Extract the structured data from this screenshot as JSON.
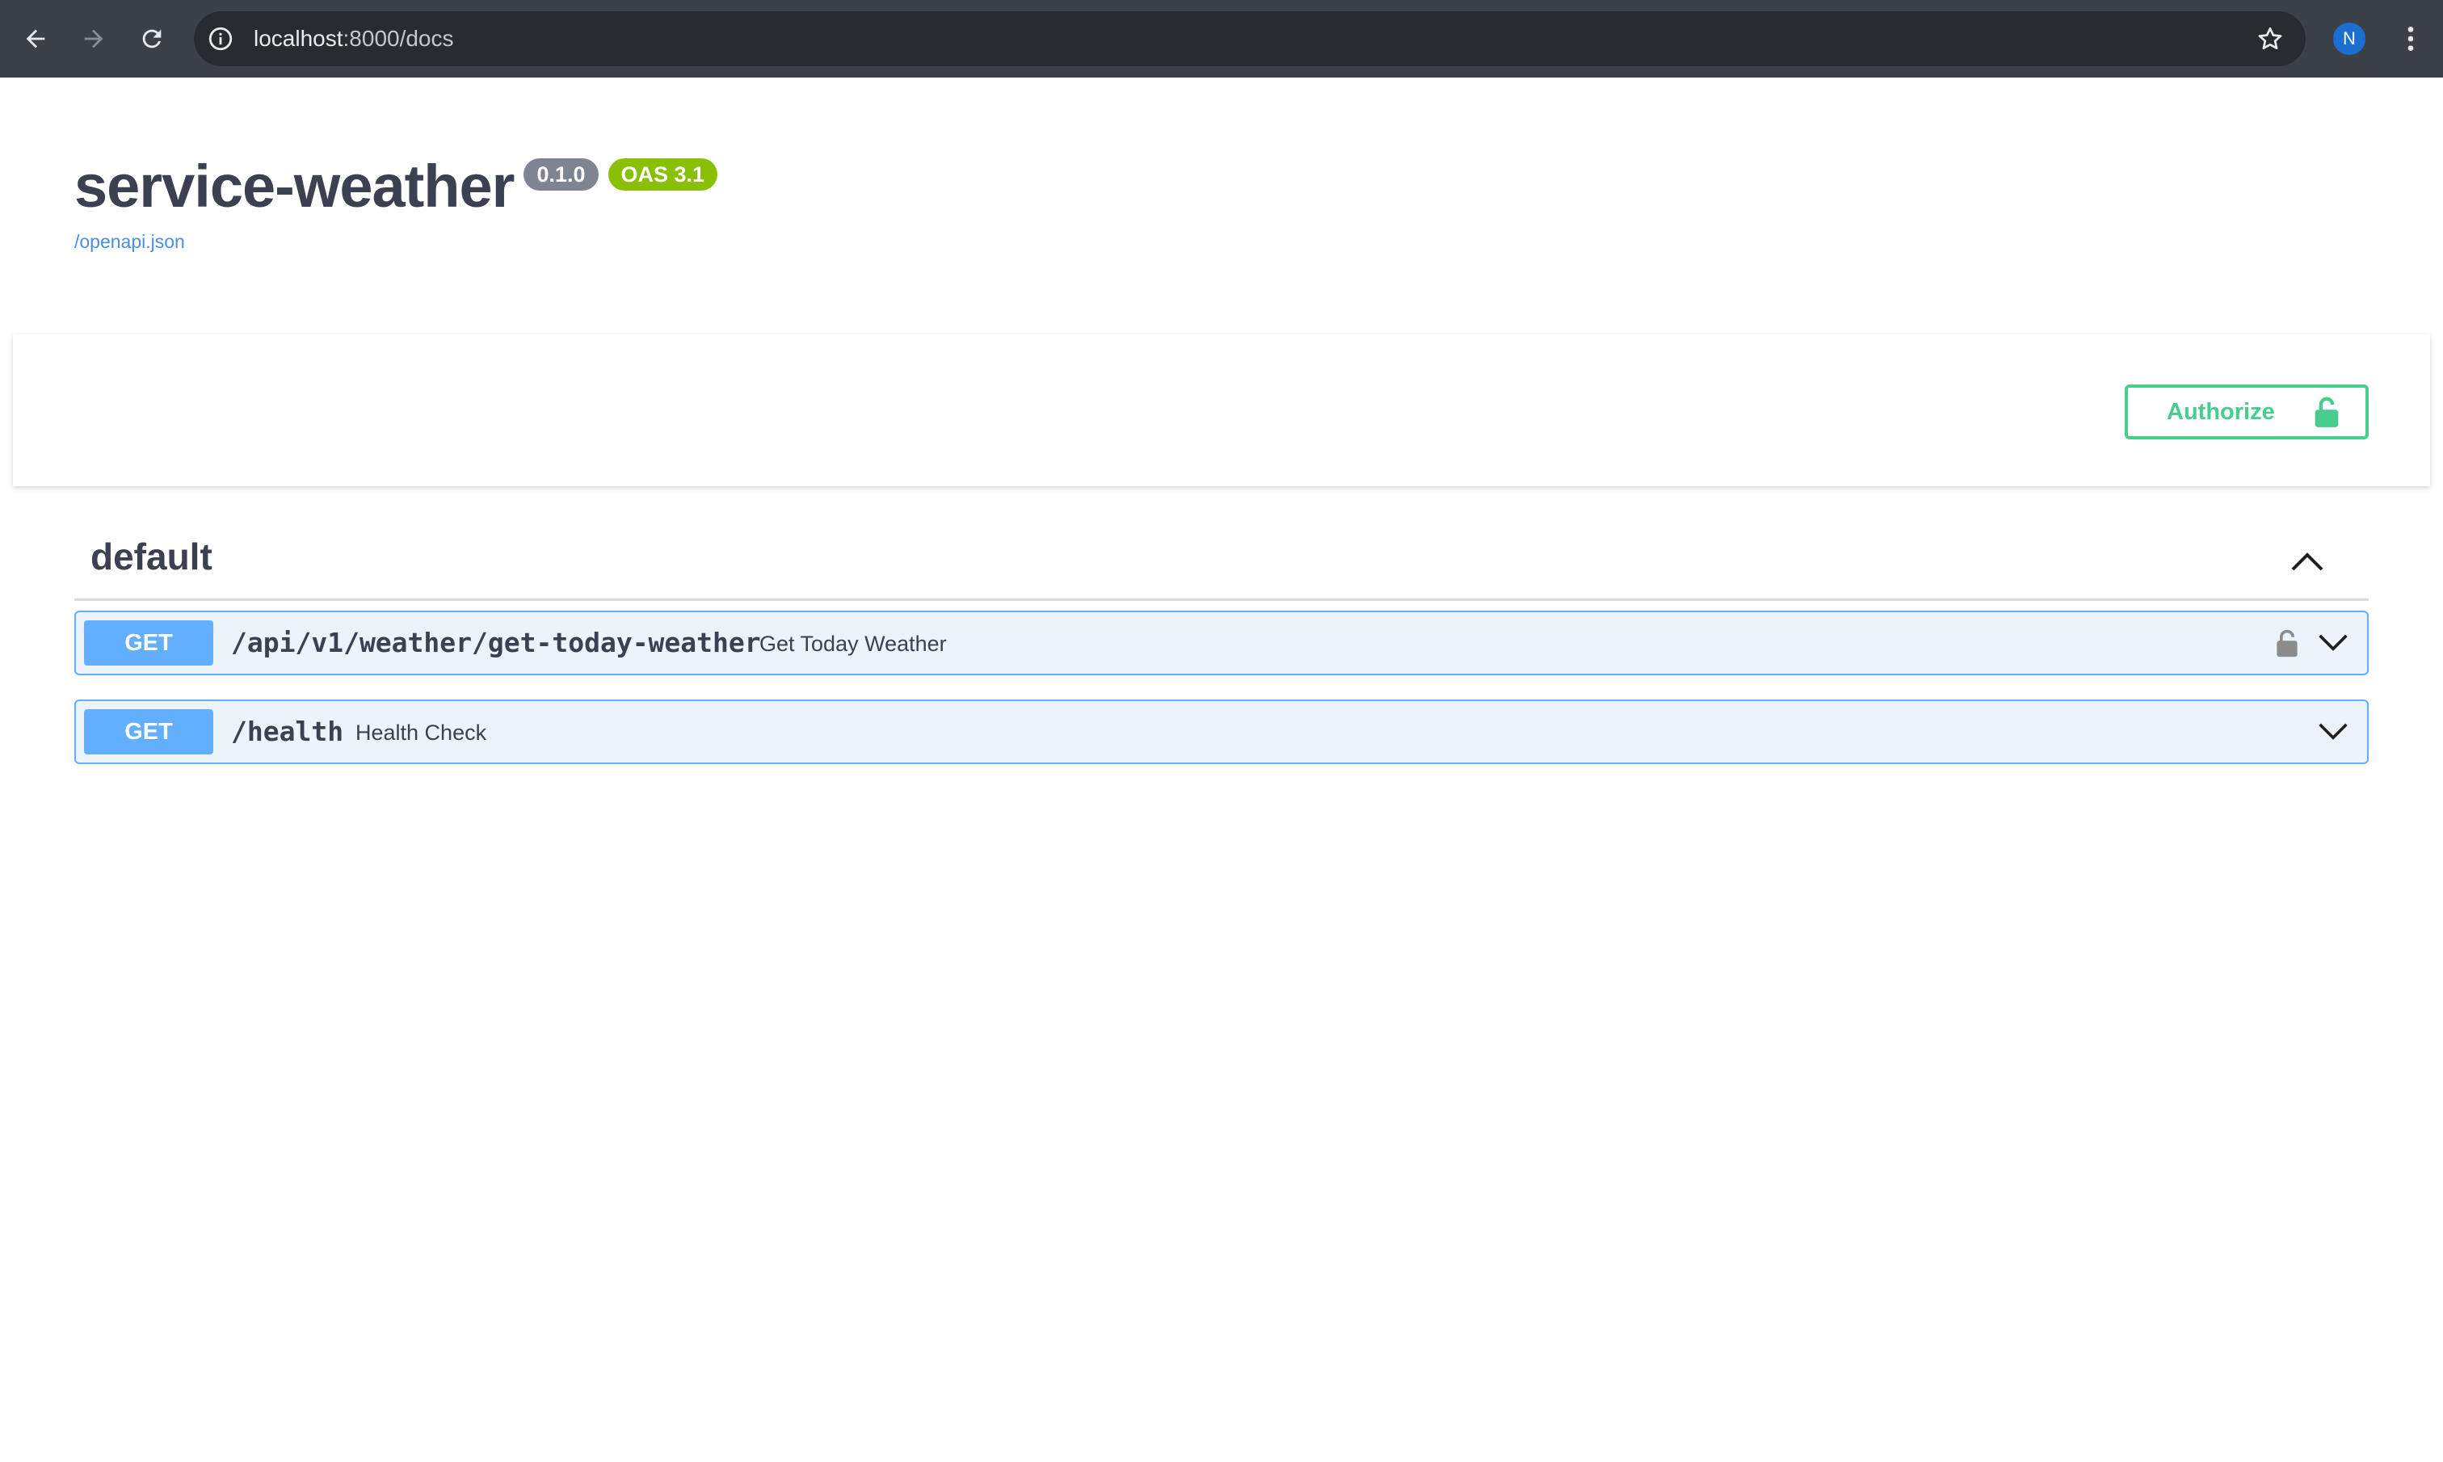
{
  "browser": {
    "url_host": "localhost",
    "url_path": ":8000/docs",
    "profile_initial": "N",
    "icons": {
      "back": "arrow-left-icon",
      "forward": "arrow-right-icon",
      "reload": "reload-icon",
      "site_info": "info-icon",
      "bookmark": "star-icon",
      "menu": "kebab-menu-icon"
    }
  },
  "header": {
    "title": "service-weather",
    "version_badge": "0.1.0",
    "oas_badge": "OAS 3.1",
    "spec_link": "/openapi.json"
  },
  "authorize": {
    "label": "Authorize",
    "icon": "unlocked-lock-icon",
    "color": "#49cc90"
  },
  "tag": {
    "name": "default",
    "toggle_icon": "chevron-up-icon"
  },
  "operations": [
    {
      "method": "GET",
      "path": "/api/v1/weather/get-today-weather",
      "summary": "Get Today Weather",
      "lock_icon": "lock-icon",
      "expand_icon": "chevron-down-icon"
    },
    {
      "method": "GET",
      "path": "/health",
      "summary": "Health Check",
      "expand_icon": "chevron-down-icon"
    }
  ],
  "colors": {
    "get_method": "#61affe",
    "get_background": "#ebf3fb",
    "title_text": "#3b4151",
    "version_badge": "#7d8492",
    "oas_badge": "#89bf04",
    "link": "#4990e2",
    "chrome_bar": "#3c4048"
  }
}
